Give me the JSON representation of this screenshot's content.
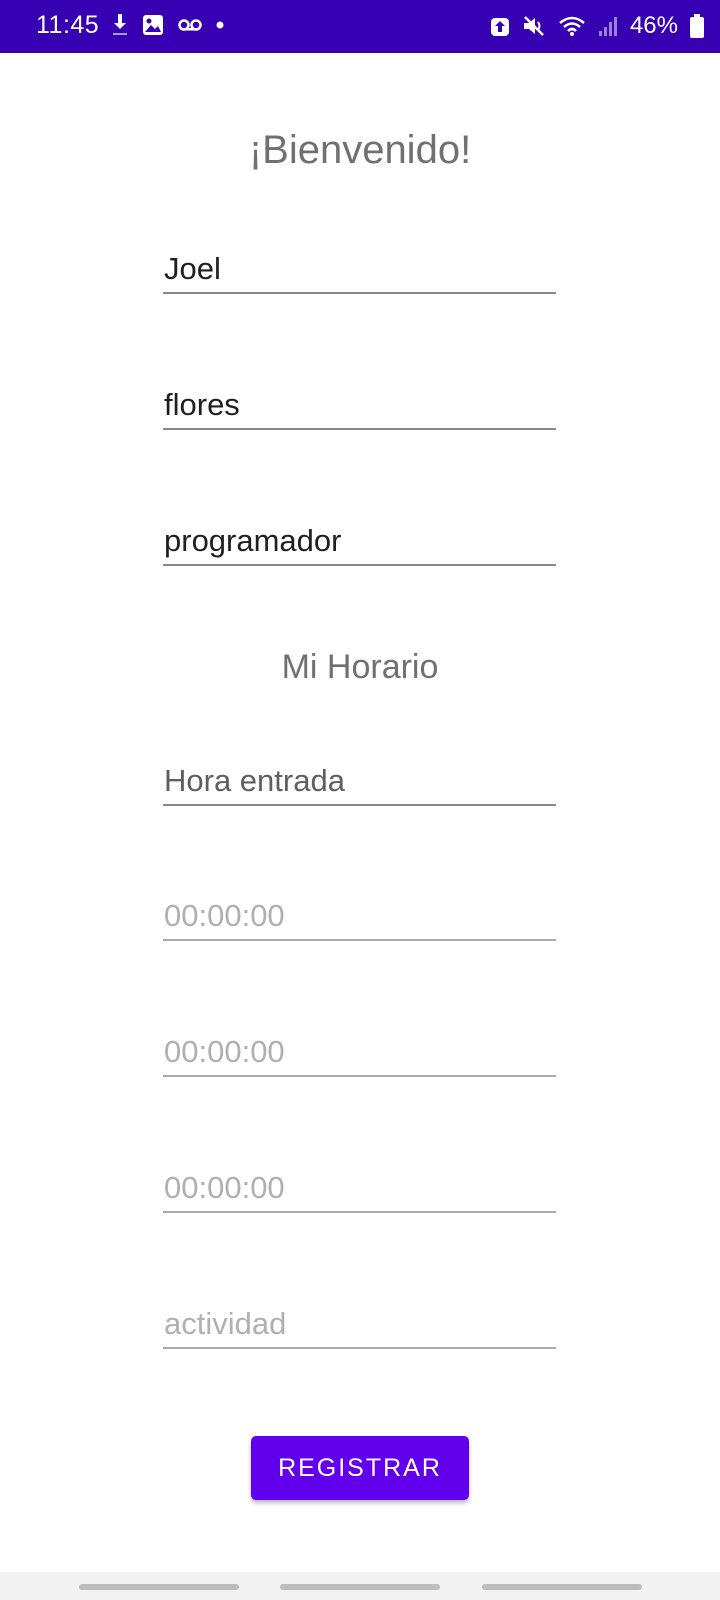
{
  "status_bar": {
    "time": "11:45",
    "battery_text": "46%",
    "left_icons": [
      "download-icon",
      "gallery-icon",
      "voicemail-icon",
      "dot-icon"
    ],
    "right_icons": [
      "battery-saver-icon",
      "mute-icon",
      "wifi-icon",
      "signal-icon",
      "battery-icon"
    ],
    "background_color": "#3700B3"
  },
  "screen": {
    "welcome_title": "¡Bienvenido!",
    "fields": {
      "name_value": "Joel",
      "lastname_value": "flores",
      "role_value": "programador"
    },
    "schedule_title": "Mi Horario",
    "schedule": {
      "entry_label": "Hora entrada",
      "time1_placeholder": "00:00:00",
      "time2_placeholder": "00:00:00",
      "time3_placeholder": "00:00:00",
      "activity_placeholder": "actividad"
    },
    "register_button": "REGISTRAR",
    "accent_color": "#6200EE"
  },
  "nav_bar": {
    "items": [
      "nav-handle",
      "nav-handle",
      "nav-handle"
    ]
  }
}
